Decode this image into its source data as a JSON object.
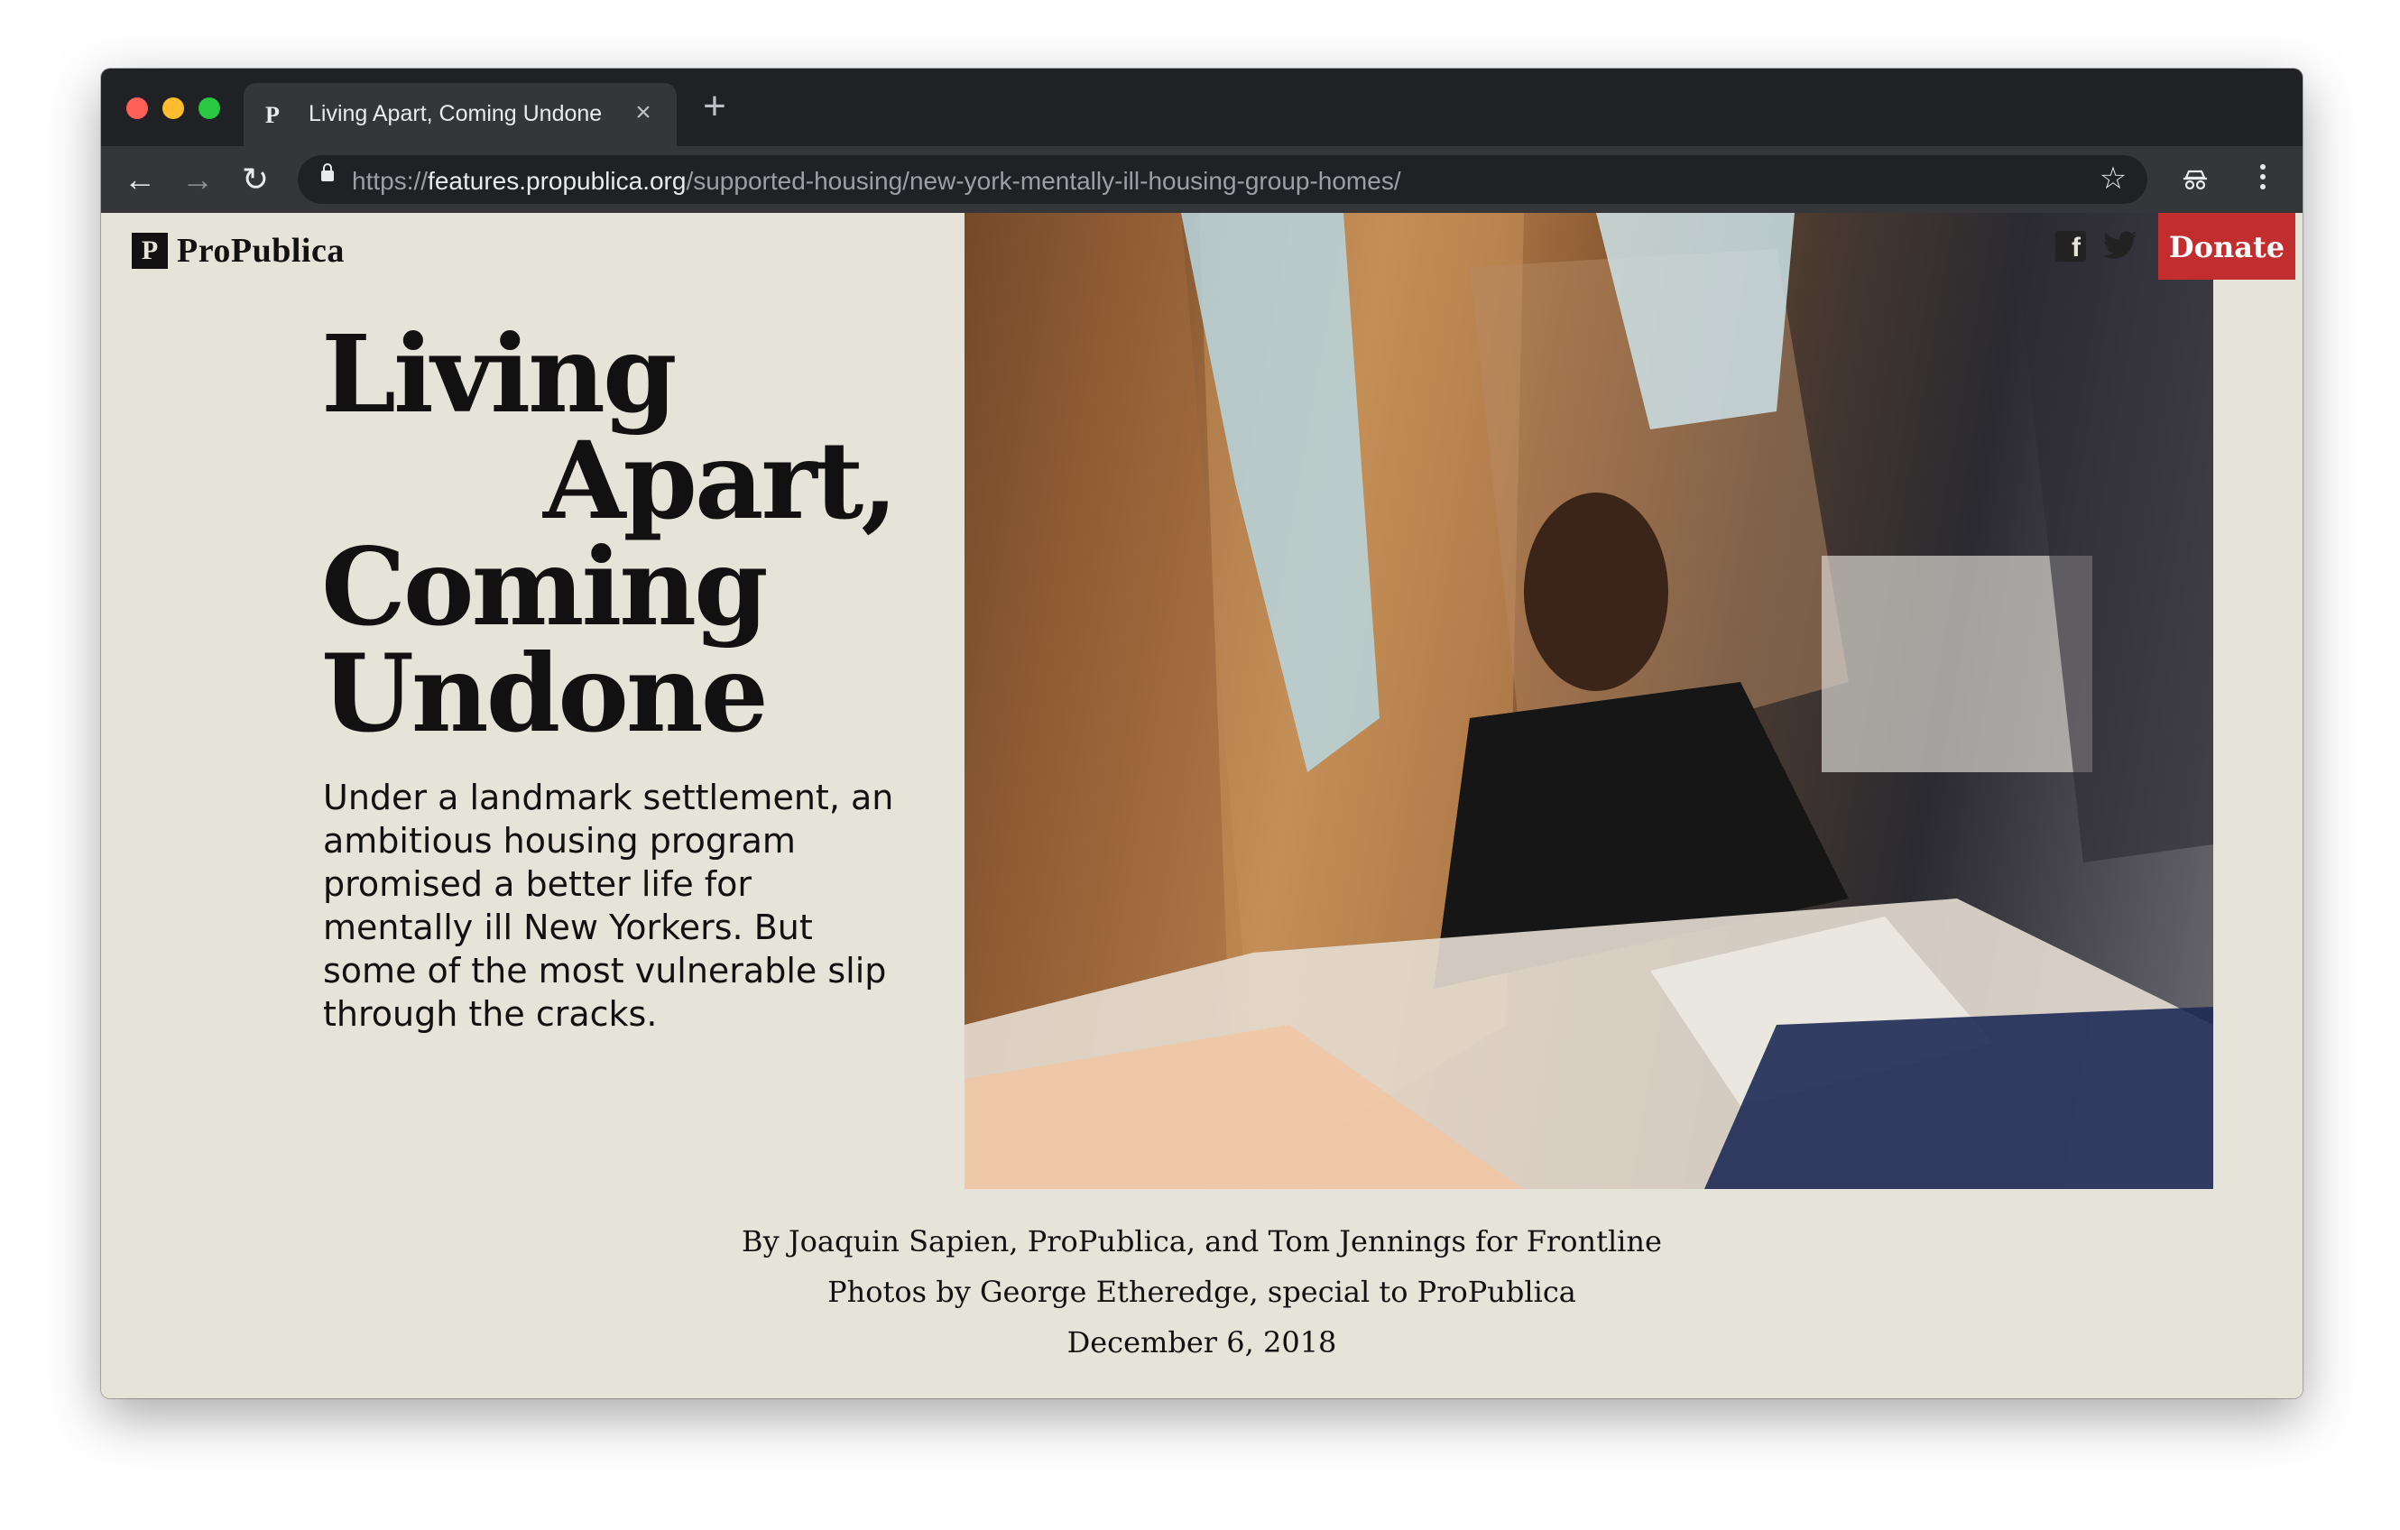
{
  "browser": {
    "tab_title": "Living Apart, Coming Undone",
    "tab_favicon": "P",
    "tab_close": "×",
    "new_tab": "+",
    "url_scheme": "https://",
    "url_host": "features.propublica.org",
    "url_path": "/supported-housing/new-york-mentally-ill-housing-group-homes/",
    "back": "←",
    "forward": "→",
    "reload": "↻",
    "star": "☆"
  },
  "page": {
    "logo_mark": "P",
    "logo_text": "ProPublica",
    "headline": [
      "Living",
      "Apart,",
      "Coming",
      "Undone"
    ],
    "dek": "Under a landmark settlement, an ambitious housing program promised a better life for mentally ill New Yorkers. But some of the most vulnerable slip through the cracks.",
    "donate_label": "Donate",
    "social_fb_glyph": "f",
    "byline": "By Joaquin Sapien, ProPublica, and Tom Jennings for Frontline",
    "photo_credit": "Photos by George Etheredge, special to ProPublica",
    "date": "December 6, 2018"
  },
  "colors": {
    "page_bg": "#e6e3d8",
    "donate_bg": "#c22d2d",
    "chrome_dark": "#202124",
    "chrome_toolbar": "#35363a"
  }
}
